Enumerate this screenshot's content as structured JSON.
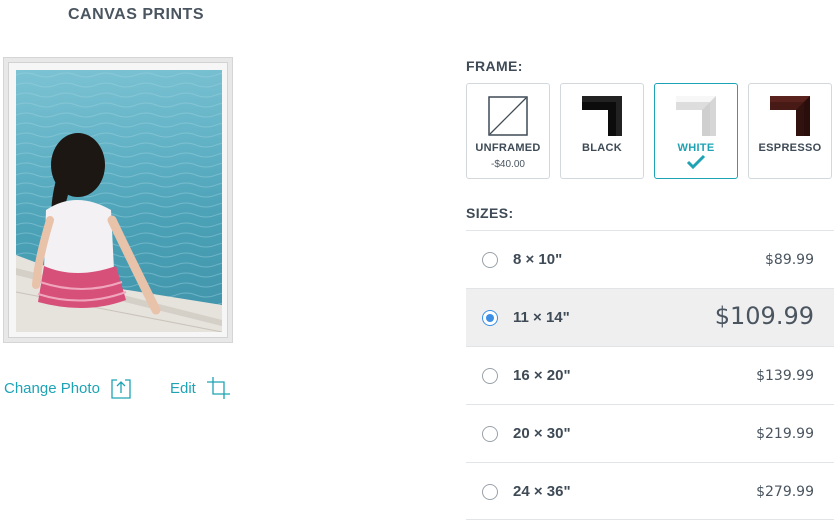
{
  "page": {
    "title": "CANVAS PRINTS"
  },
  "preview": {
    "change_photo_label": "Change Photo",
    "edit_label": "Edit"
  },
  "frame": {
    "label": "FRAME:",
    "selected": "WHITE",
    "accent_color": "#1ea3b5",
    "options": [
      {
        "name": "UNFRAMED",
        "sub": "-$40.00",
        "icon": "unframed-icon"
      },
      {
        "name": "BLACK",
        "sub": "",
        "icon": "black-frame-swatch"
      },
      {
        "name": "WHITE",
        "sub": "",
        "icon": "white-frame-swatch"
      },
      {
        "name": "ESPRESSO",
        "sub": "",
        "icon": "espresso-frame-swatch"
      }
    ]
  },
  "sizes": {
    "label": "SIZES:",
    "selected": "11 × 14\"",
    "radio_color": "#3d8fe6",
    "options": [
      {
        "name": "8 × 10\"",
        "price": "$89.99"
      },
      {
        "name": "11 × 14\"",
        "price": "$109.99"
      },
      {
        "name": "16 × 20\"",
        "price": "$139.99"
      },
      {
        "name": "20 × 30\"",
        "price": "$219.99"
      },
      {
        "name": "24 × 36\"",
        "price": "$279.99"
      }
    ]
  }
}
